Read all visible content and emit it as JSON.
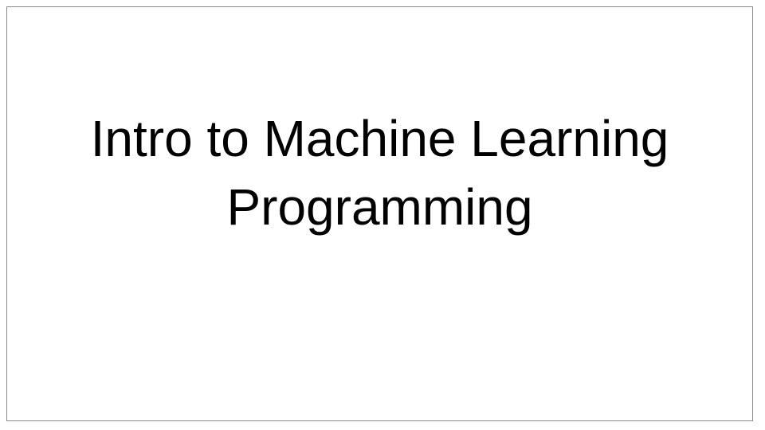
{
  "slide": {
    "title_lines": [
      "Intro to Machine Learning",
      "Programming"
    ],
    "colors": {
      "background": "#ffffff",
      "border": "#8a8a8a",
      "text": "#000000"
    }
  }
}
